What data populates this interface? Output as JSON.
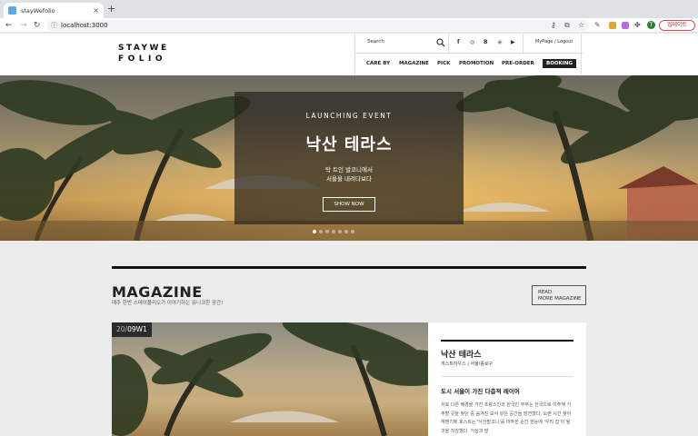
{
  "browser": {
    "tab_title": "stayWefolio",
    "tab_close": "×",
    "new_tab": "+",
    "url": "localhost:3000",
    "update_label": "업데이트",
    "profile_initial": "T"
  },
  "header": {
    "logo_line1": "STAYWE",
    "logo_line2": "FOLIO",
    "search_placeholder": "Search",
    "social": [
      "f",
      "◎",
      "B",
      "▶"
    ],
    "account": "MyPage / Logout",
    "menu": [
      "CARE BY",
      "MAGAZINE",
      "PICK",
      "PROMOTION",
      "PRE-ORDER",
      "BOOKING"
    ]
  },
  "hero": {
    "kicker": "LAUNCHING EVENT",
    "title": "낙산 테라스",
    "sub_line1": "탁 트인 발코니에서",
    "sub_line2": "서울을 내려다보다",
    "button": "SHOW NOW",
    "slide_count": 7,
    "active_slide": 0
  },
  "magazine": {
    "title": "MAGAZINE",
    "subtitle": "매주 한번 스테이폴리오가 이야기하는 유니크한 공간!",
    "read_more_line1": "READ",
    "read_more_line2": "MORE MAGAZINE",
    "badge_dim": "20/",
    "badge": "09W1",
    "card": {
      "title": "낙산 테라스",
      "meta": "게스트하우스 | 서울/종로구",
      "headline": "도시 서울이 가진 다층적 레이어",
      "body": "서로 다른 배경을 가진 프랑스인과 한국인 부부는 한국으로 이주해 거주할 곳을 찾던 중 숨겨진 보석 같은 공간을 발견했다. 오랜 시간 찾아 헤맨기에 호스트는 '낙산발코니'를 마주한 순간 한눈에 '우리 집'이 될 것을 직감했다. 거실과 발"
    }
  },
  "colors": {
    "accent": "#222222",
    "update": "#c62828"
  }
}
